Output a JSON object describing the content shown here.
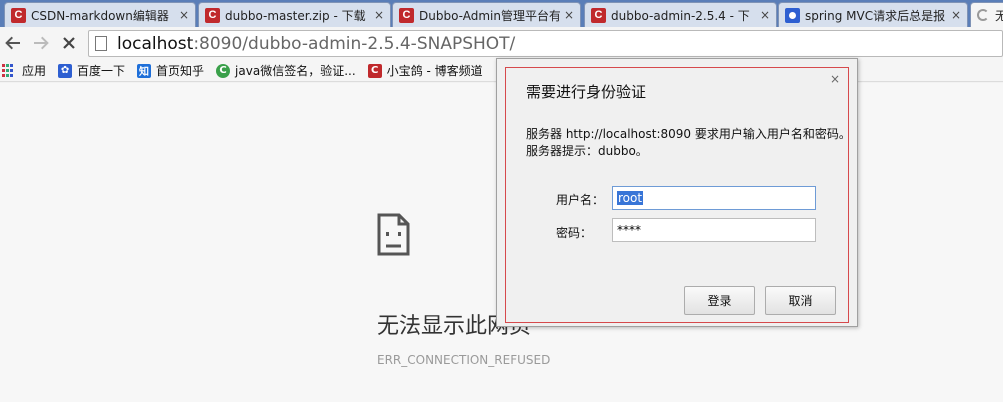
{
  "tabs": [
    {
      "title": "CSDN-markdown编辑器",
      "icon": "csdn-icon",
      "close": "×"
    },
    {
      "title": "dubbo-master.zip - 下载",
      "icon": "csdn-icon",
      "close": "×"
    },
    {
      "title": "Dubbo-Admin管理平台有",
      "icon": "csdn-icon",
      "close": "×"
    },
    {
      "title": "dubbo-admin-2.5.4 - 下",
      "icon": "csdn-icon",
      "close": "×"
    },
    {
      "title": "spring MVC请求后总是报",
      "icon": "baidu-paw-icon",
      "close": "×"
    },
    {
      "title": "无",
      "icon": "loading-spinner-icon"
    }
  ],
  "toolbar": {
    "url_host": "localhost",
    "url_rest": ":8090/dubbo-admin-2.5.4-SNAPSHOT/",
    "back_icon": "back-arrow-icon",
    "forward_icon": "forward-arrow-icon",
    "stop_icon": "stop-icon"
  },
  "bookmarks": [
    {
      "label": "应用",
      "icon": "apps-icon"
    },
    {
      "label": "百度一下",
      "icon": "baidu-paw-icon"
    },
    {
      "label": "首页知乎",
      "icon": "zhihu-icon",
      "glyph": "知"
    },
    {
      "label": "java微信签名，验证...",
      "icon": "green-c-icon",
      "glyph": "C"
    },
    {
      "label": "小宝鸽 - 博客频道",
      "icon": "csdn-icon",
      "glyph": "C"
    }
  ],
  "error_page": {
    "title": "无法显示此网页",
    "code": "ERR_CONNECTION_REFUSED"
  },
  "auth_dialog": {
    "title": "需要进行身份验证",
    "close": "×",
    "message_line1": "服务器 http://localhost:8090 要求用户输入用户名和密码。",
    "message_line2": "服务器提示：dubbo。",
    "username_label": "用户名：",
    "username_value": "root",
    "password_label": "密码：",
    "password_mask": "****",
    "login_label": "登录",
    "cancel_label": "取消"
  },
  "colors": {
    "tabstrip": "#5a7eb8",
    "csdn_red": "#c0292c",
    "dialog_border_accent": "#d6494c",
    "selection": "#3875d7"
  }
}
